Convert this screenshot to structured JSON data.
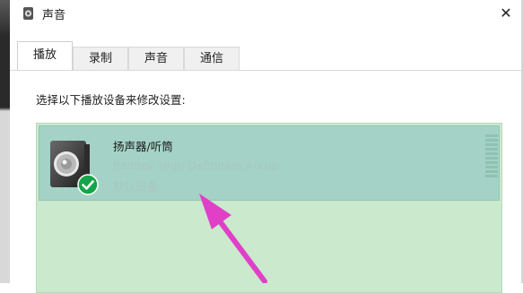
{
  "window": {
    "title": "声音",
    "close_symbol": "✕"
  },
  "tabs": [
    {
      "label": "播放",
      "active": true
    },
    {
      "label": "录制",
      "active": false
    },
    {
      "label": "声音",
      "active": false
    },
    {
      "label": "通信",
      "active": false
    }
  ],
  "panel": {
    "instruction": "选择以下播放设备来修改设置:"
  },
  "devices": [
    {
      "name": "扬声器/听筒",
      "driver": "Realtek High Definition Audio",
      "status": "默认设备",
      "icon": "speaker-icon",
      "badge": "default-check-icon",
      "selected": true
    }
  ],
  "colors": {
    "list_background": "#cbe9cd",
    "selected_row": "#a4d2c6",
    "check_badge": "#16a34a",
    "annotation_arrow": "#e040c8"
  }
}
